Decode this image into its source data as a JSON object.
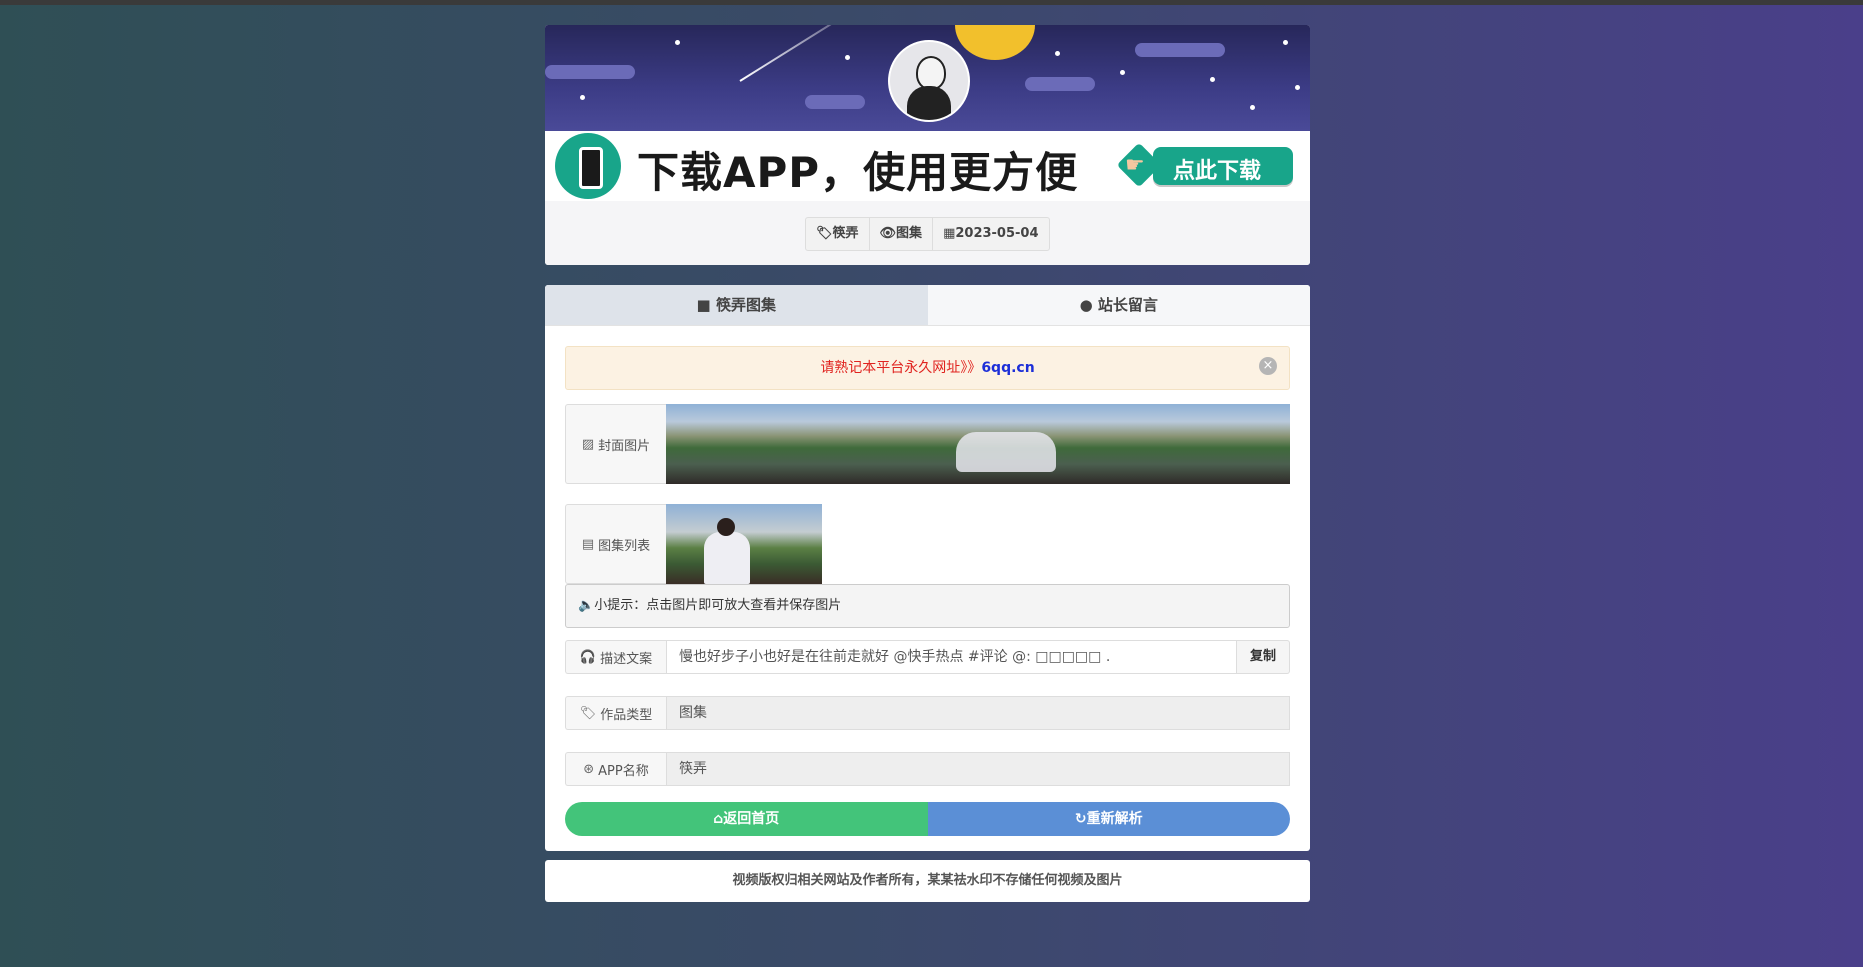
{
  "header": {
    "app_banner_text": "下载APP，使用更方便",
    "download_button_label": "点此下载"
  },
  "meta_tags": [
    {
      "icon": "tag-icon",
      "text": "筷弄"
    },
    {
      "icon": "eye-icon",
      "text": "图集"
    },
    {
      "icon": "calendar-icon",
      "text": "2023-05-04"
    }
  ],
  "tabs": [
    {
      "icon": "video-icon",
      "label": "筷弄图集",
      "active": true
    },
    {
      "icon": "comment-icon",
      "label": "站长留言",
      "active": false
    }
  ],
  "notice": {
    "text": "请熟记本平台永久网址",
    "arrows": "》》",
    "url": "6qq.cn"
  },
  "rows": {
    "cover_label": "封面图片",
    "gallery_label": "图集列表"
  },
  "tip": "小提示：点击图片即可放大查看并保存图片",
  "fields": {
    "desc_label": "描述文案",
    "desc_value": "慢也好步子小也好是在往前走就好 @快手热点 #评论 @: □□□□□ .",
    "copy_label": "复制",
    "type_label": "作品类型",
    "type_value": "图集",
    "app_label": "APP名称",
    "app_value": "筷弄"
  },
  "actions": {
    "home_label": "返回首页",
    "reparse_label": "重新解析"
  },
  "footer": "视频版权归相关网站及作者所有，某某祛水印不存储任何视频及图片",
  "colors": {
    "accent_green": "#43c47a",
    "accent_blue": "#5b8fd6",
    "notice_red": "#e0231f",
    "url_blue": "#1d2fd8",
    "app_green": "#18a58a"
  }
}
